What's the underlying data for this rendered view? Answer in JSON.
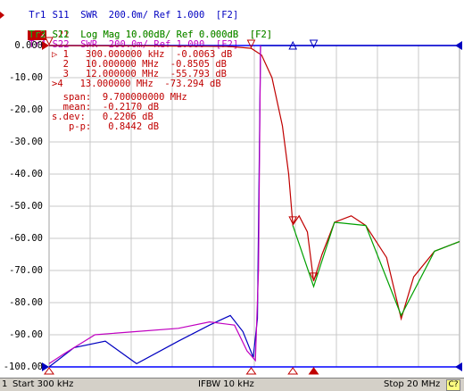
{
  "traces": [
    {
      "id": "Tr1",
      "text": "S11  SWR  200.0m/ Ref 1.000  [F2]",
      "color": "#0000c0",
      "active": false
    },
    {
      "id": "Tr2",
      "text": "S21  Log Mag 10.00dB/ Ref 0.000dB  [F2]",
      "color": "#c00000",
      "active": true
    },
    {
      "id": "Tr3",
      "text": "S12  Log Mag 10.00dB/ Ref 0.000dB  [F2]",
      "color": "#00a000",
      "active": false
    },
    {
      "id": "Tr4",
      "text": "S22  SWR  200.0m/ Ref 1.000  [F2]",
      "color": "#c000c0",
      "active": false
    }
  ],
  "y_axis_labels": [
    "0.000",
    "-10.00",
    "-20.00",
    "-30.00",
    "-40.00",
    "-50.00",
    "-60.00",
    "-70.00",
    "-80.00",
    "-90.00",
    "-100.00"
  ],
  "markers": [
    {
      "text": "▷ 1   300.000000 kHz  -0.0063 dB"
    },
    {
      "text": "  2   10.000000 MHz  -0.8505 dB"
    },
    {
      "text": "  3   12.000000 MHz  -55.793 dB"
    },
    {
      "text": ">4   13.000000 MHz  -73.294 dB"
    }
  ],
  "stats": [
    {
      "text": "  span:  9.700000000 MHz"
    },
    {
      "text": "  mean:  -0.2170 dB"
    },
    {
      "text": "s.dev:   0.2206 dB"
    },
    {
      "text": "   p-p:   0.8442 dB"
    }
  ],
  "status": {
    "channel": "1",
    "start": "Start 300 kHz",
    "ifbw": "IFBW 10 kHz",
    "stop": "Stop 20 MHz",
    "c_label": "C?"
  },
  "colors": {
    "tr1": "#0000c0",
    "tr2": "#c00000",
    "tr3": "#00a000",
    "tr4": "#c000c0",
    "grid": "#c8c8c8",
    "ref": "#0000ff"
  },
  "chart_data": {
    "type": "line",
    "x_range_mhz": [
      0.3,
      20
    ],
    "ylim": [
      -100,
      0
    ],
    "series": [
      {
        "name": "Tr2 S21",
        "points": [
          [
            0.3,
            0
          ],
          [
            5,
            -0.1
          ],
          [
            9,
            -0.3
          ],
          [
            10,
            -0.85
          ],
          [
            10.5,
            -3
          ],
          [
            11,
            -10
          ],
          [
            11.5,
            -25
          ],
          [
            11.8,
            -40
          ],
          [
            12,
            -55.8
          ],
          [
            12.3,
            -53
          ],
          [
            12.7,
            -58
          ],
          [
            13,
            -73.3
          ],
          [
            13.4,
            -65
          ],
          [
            14,
            -55
          ],
          [
            14.8,
            -53
          ],
          [
            15.5,
            -56
          ],
          [
            16.5,
            -66
          ],
          [
            17.2,
            -85
          ],
          [
            17.8,
            -72
          ],
          [
            18.8,
            -64
          ],
          [
            20,
            -61
          ]
        ]
      },
      {
        "name": "Tr3 S12",
        "points": [
          [
            12,
            -56
          ],
          [
            13,
            -75
          ],
          [
            14,
            -55
          ],
          [
            15.5,
            -56
          ],
          [
            17.2,
            -84
          ],
          [
            18.8,
            -64
          ],
          [
            20,
            -61
          ]
        ]
      },
      {
        "name": "Tr1 S11",
        "points": [
          [
            0.3,
            -100
          ],
          [
            1.5,
            -94
          ],
          [
            3,
            -92
          ],
          [
            4.5,
            -99
          ],
          [
            6.5,
            -92
          ],
          [
            8,
            -87
          ],
          [
            9,
            -84
          ],
          [
            9.6,
            -89
          ],
          [
            10.1,
            -97
          ],
          [
            10.3,
            -85
          ],
          [
            10.4,
            -30
          ],
          [
            10.45,
            0
          ],
          [
            20,
            0
          ]
        ]
      },
      {
        "name": "Tr4 S22",
        "points": [
          [
            0.3,
            -99
          ],
          [
            1,
            -96
          ],
          [
            2.5,
            -90
          ],
          [
            4.5,
            -89
          ],
          [
            6.5,
            -88
          ],
          [
            8,
            -86
          ],
          [
            9.2,
            -87
          ],
          [
            9.8,
            -95
          ],
          [
            10.2,
            -98
          ],
          [
            10.35,
            -70
          ],
          [
            10.42,
            -20
          ],
          [
            10.45,
            0
          ]
        ]
      }
    ]
  }
}
